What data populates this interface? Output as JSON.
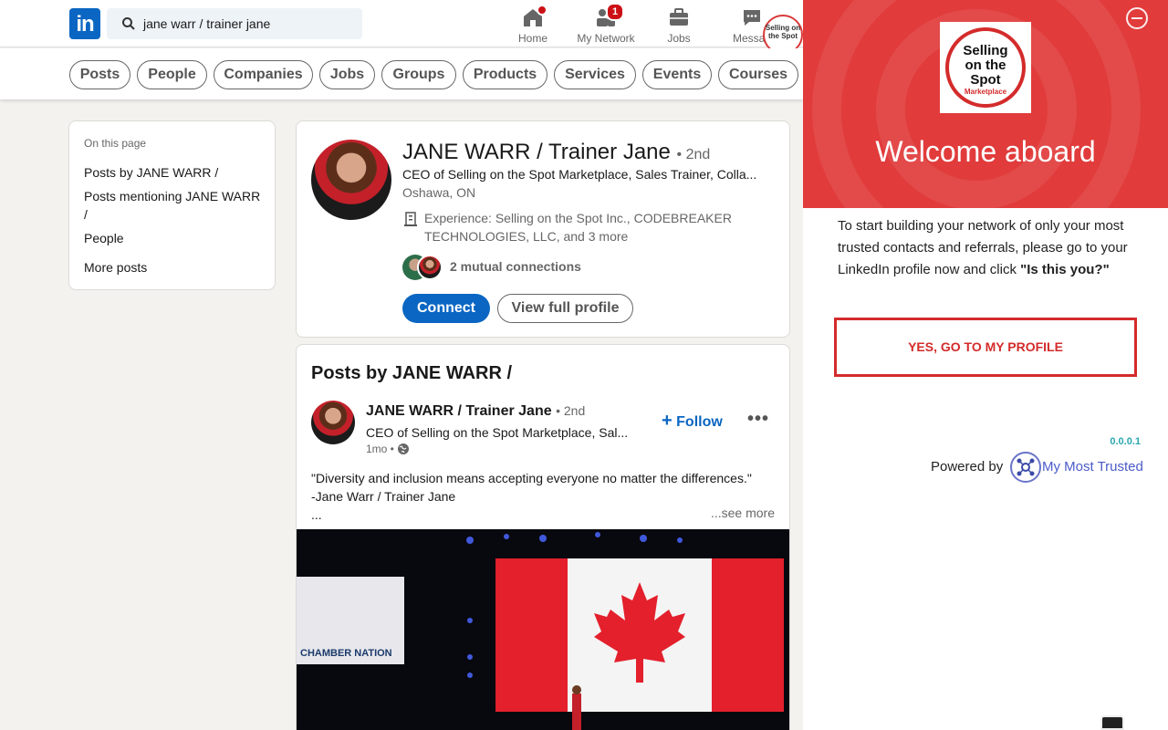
{
  "nav": {
    "search_value": "jane warr / trainer jane",
    "items": [
      {
        "label": "Home",
        "icon": "home-icon",
        "badge": ""
      },
      {
        "label": "My Network",
        "icon": "network-icon",
        "badge": "1"
      },
      {
        "label": "Jobs",
        "icon": "briefcase-icon",
        "badge": ""
      },
      {
        "label": "Messag",
        "icon": "messaging-icon",
        "badge": ""
      }
    ],
    "me_logo_text": "Selling on the Spot"
  },
  "filters": [
    "Posts",
    "People",
    "Companies",
    "Jobs",
    "Groups",
    "Products",
    "Services",
    "Events",
    "Courses"
  ],
  "sidebar": {
    "title": "On this page",
    "links": [
      "Posts by JANE WARR /",
      "Posts mentioning JANE WARR /",
      "People",
      "More posts"
    ]
  },
  "profile": {
    "name": "JANE WARR / Trainer Jane",
    "degree": "• 2nd",
    "headline": "CEO of Selling on the Spot Marketplace, Sales Trainer, Colla...",
    "location": "Oshawa, ON",
    "experience_line1": "Experience: Selling on the Spot Inc., CODEBREAKER",
    "experience_line2": "TECHNOLOGIES, LLC, and 3 more",
    "mutual": "2 mutual connections",
    "connect_label": "Connect",
    "view_label": "View full profile"
  },
  "post": {
    "heading": "Posts by JANE WARR /",
    "author": "JANE WARR / Trainer Jane",
    "degree": "• 2nd",
    "headline": "CEO of Selling on the Spot Marketplace, Sal...",
    "time": "1mo •",
    "follow_label": "Follow",
    "quote_line1": "\"Diversity and inclusion means accepting everyone no matter the differences.\"",
    "quote_line2": "-Jane Warr / Trainer Jane",
    "quote_line3": "...",
    "see_more": "...see more",
    "image_sign": "CHAMBER NATION"
  },
  "extension": {
    "brand_line1": "Selling",
    "brand_line2": "on the",
    "brand_line3": "Spot",
    "brand_line4": "Marketplace",
    "welcome": "Welcome aboard",
    "body_text": "To start building your network of only your most trusted contacts and referrals, please go to your LinkedIn profile now and click ",
    "body_bold": "\"Is this you?\"",
    "cta_label": "YES, GO TO MY PROFILE",
    "version": "0.0.0.1",
    "powered_by": "Powered by",
    "powered_name": "My Most Trusted"
  },
  "colors": {
    "linkedin_blue": "#0a66c2",
    "extension_red": "#e13b3b",
    "cta_red": "#d42b2b",
    "badge_red": "#cc1016"
  }
}
